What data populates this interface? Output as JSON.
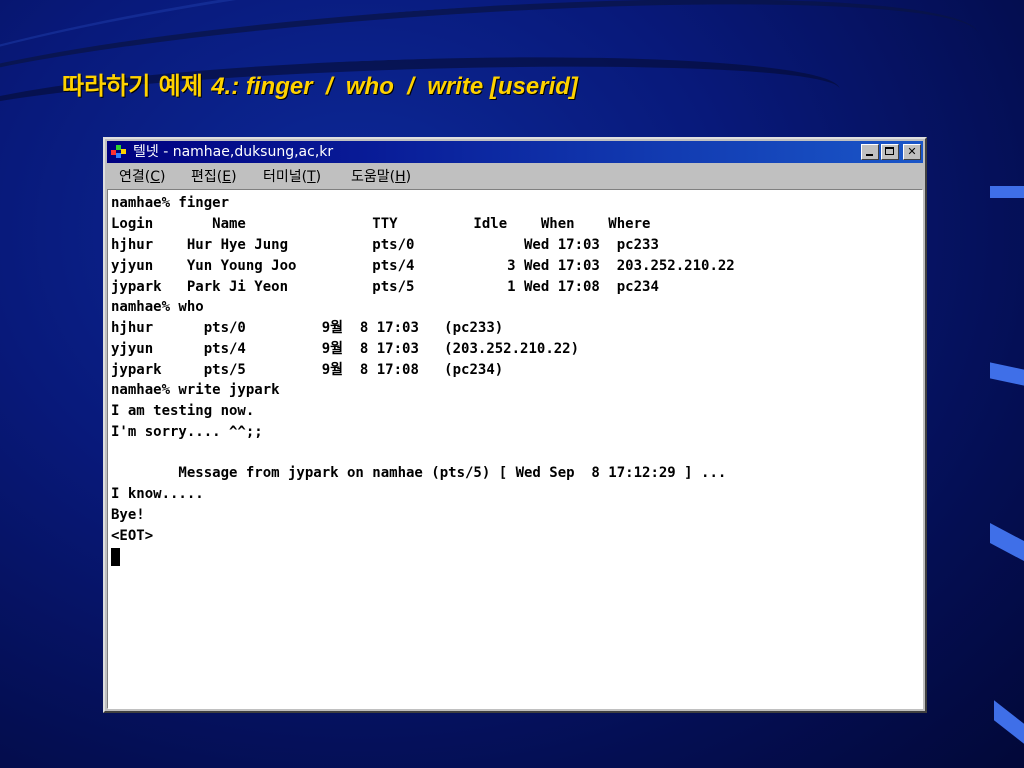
{
  "slide": {
    "title_ko": "따라하기 예제 ",
    "title_en": "4.: finger  /  who  /  write [userid]"
  },
  "window": {
    "title": "텔넷 - namhae,duksung,ac,kr",
    "icon": "telnet-app-icon",
    "buttons": {
      "minimize": "minimize-icon",
      "maximize": "maximize-icon",
      "close": "close-icon"
    }
  },
  "menu": [
    {
      "pre": "연결(",
      "key": "C",
      "post": ")"
    },
    {
      "pre": "편집(",
      "key": "E",
      "post": ")"
    },
    {
      "pre": "터미널(",
      "key": "T",
      "post": ")"
    },
    {
      "pre": "도움말(",
      "key": "H",
      "post": ")"
    }
  ],
  "terminal": {
    "lines": [
      "namhae% finger",
      "Login       Name               TTY         Idle    When    Where",
      "hjhur    Hur Hye Jung          pts/0             Wed 17:03  pc233",
      "yjyun    Yun Young Joo         pts/4           3 Wed 17:03  203.252.210.22",
      "jypark   Park Ji Yeon          pts/5           1 Wed 17:08  pc234",
      "namhae% who",
      "hjhur      pts/0         9월  8 17:03   (pc233)",
      "yjyun      pts/4         9월  8 17:03   (203.252.210.22)",
      "jypark     pts/5         9월  8 17:08   (pc234)",
      "namhae% write jypark",
      "I am testing now.",
      "I'm sorry.... ^^;;",
      "",
      "        Message from jypark on namhae (pts/5) [ Wed Sep  8 17:12:29 ] ...",
      "I know.....",
      "Bye!",
      "<EOT>"
    ]
  },
  "colors": {
    "title_yellow": "#ffd200",
    "titlebar": "#000080",
    "window_gray": "#c0c0c0"
  }
}
